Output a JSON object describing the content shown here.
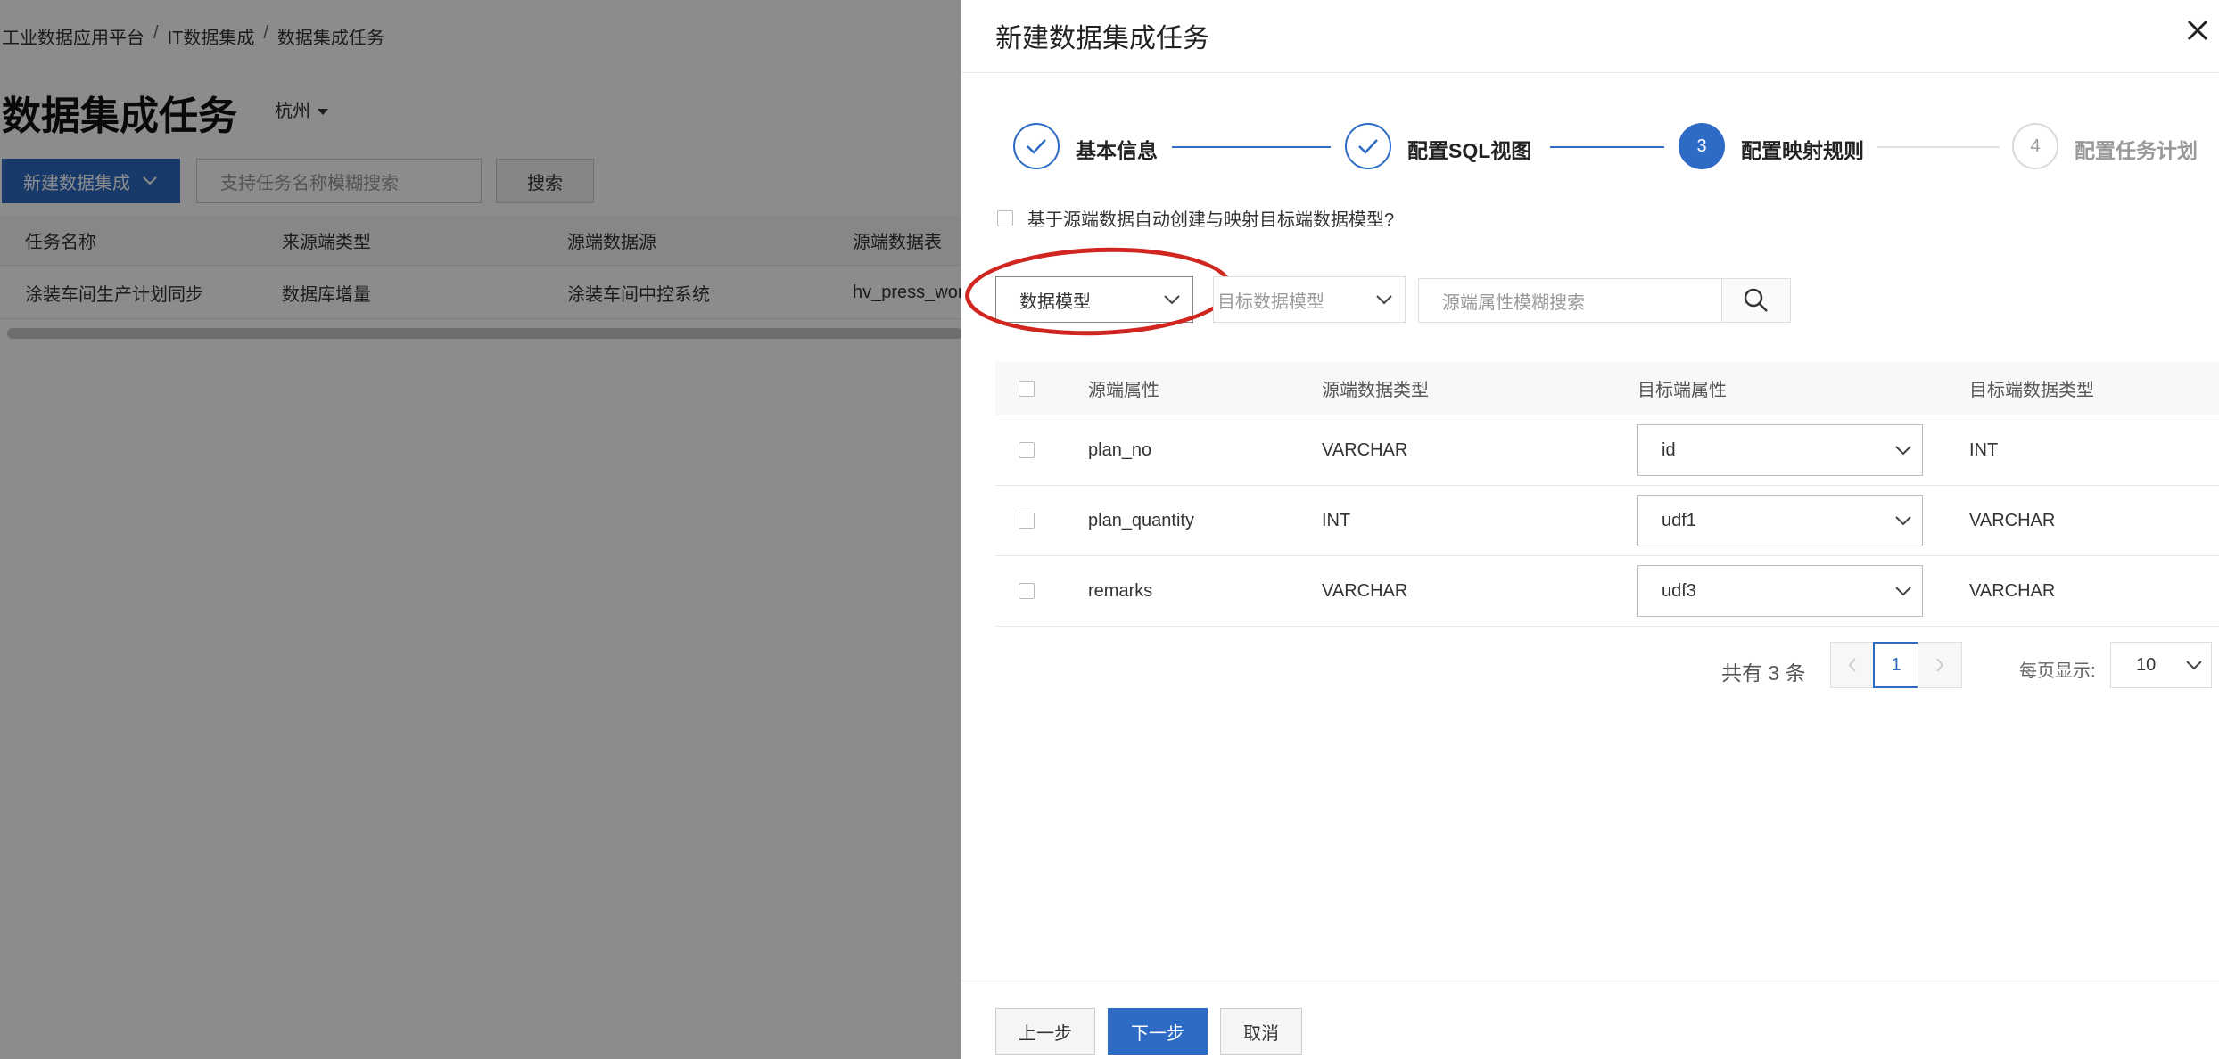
{
  "background": {
    "breadcrumb": [
      "工业数据应用平台",
      "IT数据集成",
      "数据集成任务"
    ],
    "breadcrumb_sep": "/",
    "page_title": "数据集成任务",
    "region": "杭州",
    "new_button": "新建数据集成",
    "search_placeholder": "支持任务名称模糊搜索",
    "search_button": "搜索",
    "table": {
      "headers": [
        "任务名称",
        "来源端类型",
        "源端数据源",
        "源端数据表"
      ],
      "rows": [
        [
          "涂装车间生产计划同步",
          "数据库增量",
          "涂装车间中控系统",
          "hv_press_wor"
        ]
      ]
    }
  },
  "drawer": {
    "title": "新建数据集成任务",
    "steps": [
      {
        "label": "基本信息",
        "state": "done",
        "number": ""
      },
      {
        "label": "配置SQL视图",
        "state": "done",
        "number": ""
      },
      {
        "label": "配置映射规则",
        "state": "active",
        "number": "3"
      },
      {
        "label": "配置任务计划",
        "state": "todo",
        "number": "4"
      }
    ],
    "auto_create_label": "基于源端数据自动创建与映射目标端数据模型?",
    "filters": {
      "model_type": "数据模型",
      "target_model_placeholder": "目标数据模型",
      "attr_search_placeholder": "源端属性模糊搜索"
    },
    "mapping_table": {
      "headers": [
        "源端属性",
        "源端数据类型",
        "目标端属性",
        "目标端数据类型"
      ],
      "rows": [
        {
          "source_attr": "plan_no",
          "source_type": "VARCHAR",
          "target_attr": "id",
          "target_type": "INT"
        },
        {
          "source_attr": "plan_quantity",
          "source_type": "INT",
          "target_attr": "udf1",
          "target_type": "VARCHAR"
        },
        {
          "source_attr": "remarks",
          "source_type": "VARCHAR",
          "target_attr": "udf3",
          "target_type": "VARCHAR"
        }
      ]
    },
    "pagination": {
      "total_text": "共有 3 条",
      "current_page": "1",
      "page_size_label": "每页显示:",
      "page_size": "10"
    },
    "footer": {
      "prev": "上一步",
      "next": "下一步",
      "cancel": "取消"
    }
  },
  "colors": {
    "primary": "#2d6bc4",
    "highlight": "#d0261f"
  }
}
